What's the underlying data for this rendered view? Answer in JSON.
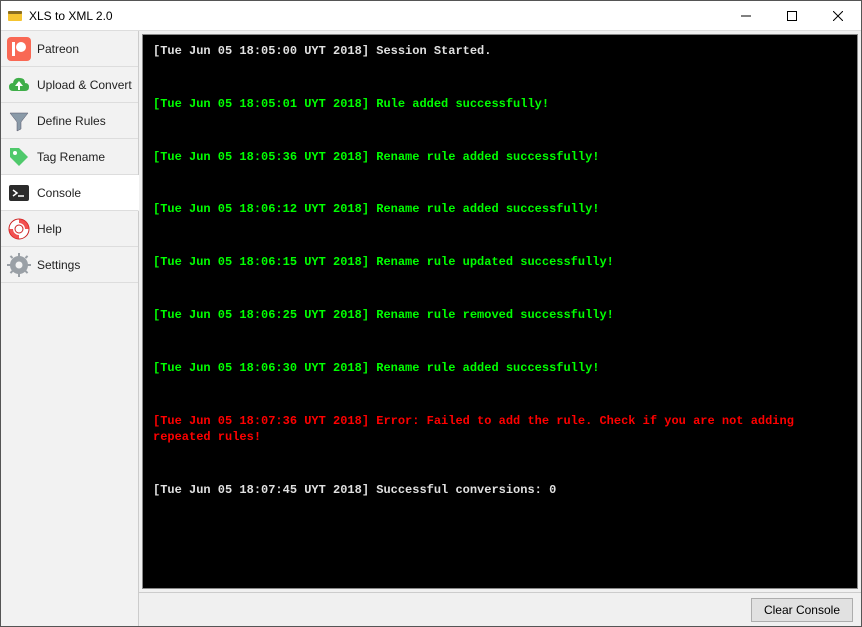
{
  "window": {
    "title": "XLS to XML 2.0"
  },
  "sidebar": {
    "items": [
      {
        "label": "Patreon"
      },
      {
        "label": "Upload & Convert"
      },
      {
        "label": "Define Rules"
      },
      {
        "label": "Tag Rename"
      },
      {
        "label": "Console"
      },
      {
        "label": "Help"
      },
      {
        "label": "Settings"
      }
    ]
  },
  "console": {
    "logs": [
      {
        "color": "white",
        "text": "[Tue Jun 05 18:05:00 UYT 2018] Session Started."
      },
      {
        "color": "green",
        "text": "[Tue Jun 05 18:05:01 UYT 2018] Rule added successfully!"
      },
      {
        "color": "green",
        "text": "[Tue Jun 05 18:05:36 UYT 2018] Rename rule added successfully!"
      },
      {
        "color": "green",
        "text": "[Tue Jun 05 18:06:12 UYT 2018] Rename rule added successfully!"
      },
      {
        "color": "green",
        "text": "[Tue Jun 05 18:06:15 UYT 2018] Rename rule updated successfully!"
      },
      {
        "color": "green",
        "text": "[Tue Jun 05 18:06:25 UYT 2018] Rename rule removed successfully!"
      },
      {
        "color": "green",
        "text": "[Tue Jun 05 18:06:30 UYT 2018] Rename rule added successfully!"
      },
      {
        "color": "red",
        "text": "[Tue Jun 05 18:07:36 UYT 2018] Error: Failed to add the rule. Check if you are not adding repeated rules!"
      },
      {
        "color": "white",
        "text": "[Tue Jun 05 18:07:45 UYT 2018] Successful conversions:  0"
      }
    ]
  },
  "footer": {
    "clear_label": "Clear Console"
  }
}
